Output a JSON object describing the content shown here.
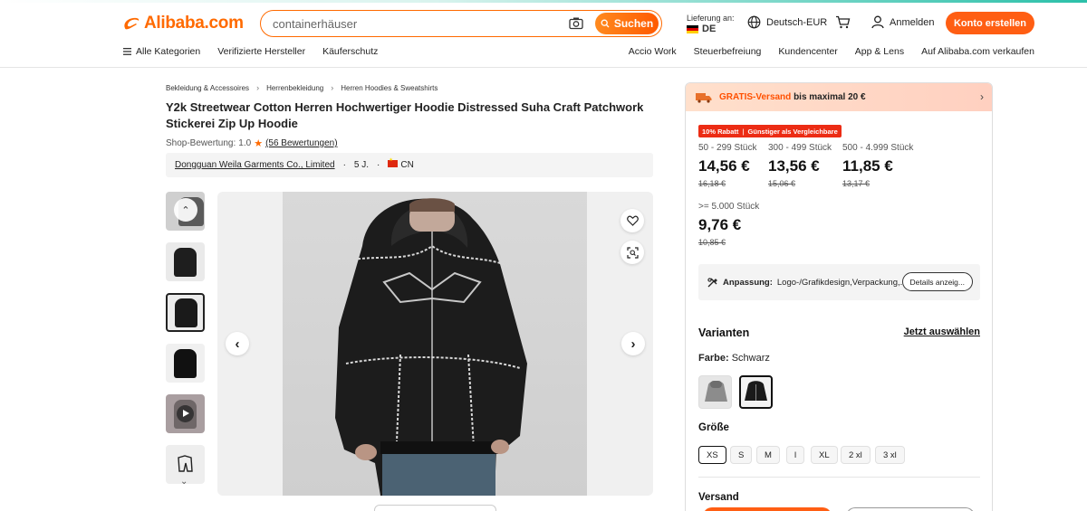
{
  "header": {
    "logo": "Alibaba.com",
    "search_value": "containerhäuser",
    "search_button": "Suchen",
    "deliver_label": "Lieferung an:",
    "deliver_country": "DE",
    "language_currency": "Deutsch-EUR",
    "login": "Anmelden",
    "create_account": "Konto erstellen",
    "brand_color": "#ff6a00"
  },
  "nav": {
    "left": [
      "Alle Kategorien",
      "Verifizierte Hersteller",
      "Käuferschutz"
    ],
    "right": [
      "Accio Work",
      "Steuerbefreiung",
      "Kundencenter",
      "App & Lens",
      "Auf Alibaba.com verkaufen"
    ]
  },
  "breadcrumb": [
    "Bekleidung & Accessoires",
    "Herrenbekleidung",
    "Herren Hoodies & Sweatshirts"
  ],
  "product": {
    "title": "Y2k Streetwear Cotton Herren Hochwertiger Hoodie Distressed Suha Craft Patchwork Stickerei Zip Up Hoodie",
    "rating_label": "Shop-Bewertung:",
    "rating_value": "1.0",
    "reviews": "(56 Bewertungen)",
    "supplier_name": "Dongguan Weila Garments Co., Limited",
    "supplier_years": "5 J.",
    "supplier_country": "CN"
  },
  "shipping": {
    "free_label": "GRATIS-Versand",
    "rest": "bis maximal 20 €"
  },
  "badges": [
    "10% Rabatt",
    "Günstiger als Vergleichbare"
  ],
  "tiers": [
    {
      "qty": "50 - 299 Stück",
      "price": "14,56 €",
      "old": "16,18 €"
    },
    {
      "qty": "300 - 499 Stück",
      "price": "13,56 €",
      "old": "15,06 €"
    },
    {
      "qty": "500 - 4.999 Stück",
      "price": "11,85 €",
      "old": "13,17 €"
    },
    {
      "qty": ">= 5.000 Stück",
      "price": "9,76 €",
      "old": "10,85 €"
    }
  ],
  "customization": {
    "label": "Anpassung:",
    "value": "Logo-/Grafikdesign,Verpackung,...",
    "details_button": "Details anzeig..."
  },
  "variants": {
    "title": "Varianten",
    "select_now": "Jetzt auswählen",
    "color_label": "Farbe:",
    "color_value": "Schwarz",
    "size_title": "Größe",
    "sizes": [
      "XS",
      "S",
      "M",
      "l",
      "XL",
      "2 xl",
      "3 xl"
    ],
    "selected_size": "XS"
  },
  "shipping_section_title": "Versand"
}
